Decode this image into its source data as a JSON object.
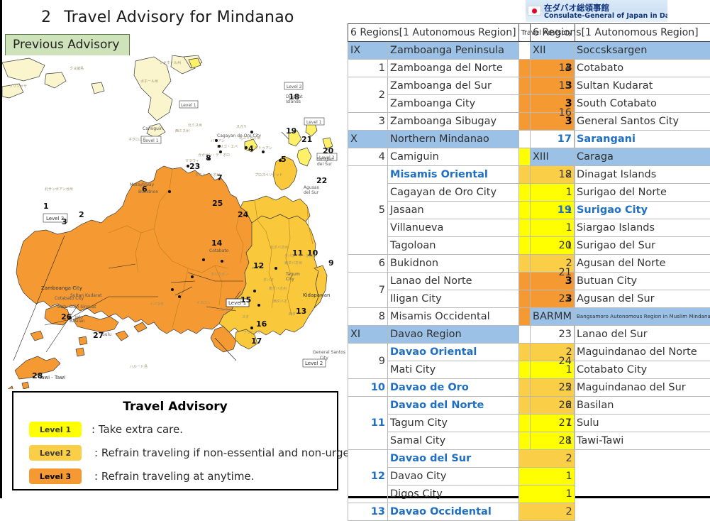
{
  "page": {
    "number": "2",
    "title": "Travel Advisory for Mindanao",
    "previous_advisory_button": "Previous Advisory"
  },
  "consulate": {
    "japanese": "在ダバオ総領事館",
    "english": "Consulate-General of Japan in Davao",
    "flag_icon": "japan-flag-icon",
    "accent_color": "#12367e"
  },
  "legend": {
    "title": "Travel Advisory",
    "items": [
      {
        "chip": "Level 1",
        "text": ": Take extra care.",
        "color": "#FFFF00"
      },
      {
        "chip": "Level 2",
        "text": ": Refrain traveling if non-essential and non-urgent.",
        "color": "#FBCE47"
      },
      {
        "chip": "Level 3",
        "text": ": Refrain traveling at anytime.",
        "color": "#F59A32"
      }
    ]
  },
  "table_headers": {
    "regions": "6 Regions[1 Autonomous Region]",
    "advisory": "Travel Advisory"
  },
  "table_left": [
    {
      "kind": "region",
      "code": "IX",
      "name": "Zamboanga Peninsula",
      "level": ""
    },
    {
      "kind": "item",
      "num": "1",
      "name": "Zamboanga del Norte",
      "level": "3"
    },
    {
      "kind": "item",
      "num": "2",
      "name": "Zamboanga del Sur",
      "level": "3",
      "rowspan": 2
    },
    {
      "kind": "sub",
      "name": "Zamboanga City",
      "level": "3"
    },
    {
      "kind": "item",
      "num": "3",
      "name": "Zamboanga Sibugay",
      "level": "3"
    },
    {
      "kind": "region",
      "code": "X",
      "name": "Northern Mindanao",
      "level": ""
    },
    {
      "kind": "item",
      "num": "4",
      "name": "Camiguin",
      "level": "1"
    },
    {
      "kind": "item",
      "num": "5",
      "name": "Misamis Oriental",
      "level": "2",
      "highlight": true,
      "rowspan": 5
    },
    {
      "kind": "sub",
      "name": "Cagayan de Oro City",
      "level": "1"
    },
    {
      "kind": "sub",
      "name": "Jasaan",
      "level": "1"
    },
    {
      "kind": "sub",
      "name": "Villanueva",
      "level": "1"
    },
    {
      "kind": "sub",
      "name": "Tagoloan",
      "level": "1"
    },
    {
      "kind": "item",
      "num": "6",
      "name": "Bukidnon",
      "level": "2"
    },
    {
      "kind": "item",
      "num": "7",
      "name": "Lanao del Norte",
      "level": "3",
      "rowspan": 2
    },
    {
      "kind": "sub",
      "name": "Iligan City",
      "level": "3"
    },
    {
      "kind": "item",
      "num": "8",
      "name": "Misamis Occidental",
      "level": "3"
    },
    {
      "kind": "region",
      "code": "XI",
      "name": "Davao Region",
      "level": ""
    },
    {
      "kind": "item",
      "num": "9",
      "name": "Davao Oriental",
      "level": "2",
      "highlight": true,
      "rowspan": 2
    },
    {
      "kind": "sub",
      "name": "Mati City",
      "level": "1"
    },
    {
      "kind": "item",
      "num": "10",
      "name": "Davao de Oro",
      "level": "2",
      "highlight": true,
      "num_hl": true
    },
    {
      "kind": "item",
      "num": "11",
      "name": "Davao del Norte",
      "level": "2",
      "highlight": true,
      "num_hl": true,
      "rowspan": 3
    },
    {
      "kind": "sub",
      "name": "Tagum City",
      "level": "1"
    },
    {
      "kind": "sub",
      "name": "Samal City",
      "level": "1"
    },
    {
      "kind": "item",
      "num": "12",
      "name": "Davao del Sur",
      "level": "2",
      "highlight": true,
      "num_hl": true,
      "rowspan": 3
    },
    {
      "kind": "sub",
      "name": "Davao City",
      "level": "1"
    },
    {
      "kind": "sub",
      "name": "Digos City",
      "level": "1"
    },
    {
      "kind": "item",
      "num": "13",
      "name": "Davao Occidental",
      "level": "2",
      "highlight": true,
      "num_hl": true
    }
  ],
  "table_right": [
    {
      "kind": "region",
      "code": "XII",
      "name": "Soccsksargen",
      "level": ""
    },
    {
      "kind": "item",
      "num": "14",
      "name": "Cotabato",
      "level": "3"
    },
    {
      "kind": "item",
      "num": "15",
      "name": "Sultan Kudarat",
      "level": "3"
    },
    {
      "kind": "item",
      "num": "16",
      "name": "South Cotabato",
      "level": "2",
      "rowspan": 2
    },
    {
      "kind": "sub",
      "name": "General Santos City",
      "level": "1"
    },
    {
      "kind": "item",
      "num": "17",
      "name": "Sarangani",
      "level": "3",
      "highlight": true,
      "num_hl": true
    },
    {
      "kind": "region",
      "code": "XIII",
      "name": "Caraga",
      "level": ""
    },
    {
      "kind": "item",
      "num": "18",
      "name": "Dinagat Islands",
      "level": "1"
    },
    {
      "kind": "item",
      "num": "19",
      "name": "Surigao del Norte",
      "level": "2",
      "num_hl": true,
      "rowspan": 3
    },
    {
      "kind": "sub",
      "name": "Surigao City",
      "level": "2",
      "highlight": true
    },
    {
      "kind": "sub",
      "name": "Siargao Islands",
      "level": "1"
    },
    {
      "kind": "item",
      "num": "20",
      "name": "Surigao del Sur",
      "level": "2"
    },
    {
      "kind": "item",
      "num": "21",
      "name": "Agusan del Norte",
      "level": "2",
      "rowspan": 2
    },
    {
      "kind": "sub",
      "name": "Butuan City",
      "level": "1"
    },
    {
      "kind": "item",
      "num": "22",
      "name": "Agusan del Sur",
      "level": "2"
    },
    {
      "kind": "region",
      "code": "BARMM",
      "name": "Bangsamoro Autonomous Region in Muslim Mindanao",
      "level": "",
      "small": true
    },
    {
      "kind": "item",
      "num": "23",
      "name": "Lanao del Sur",
      "level": "3"
    },
    {
      "kind": "item",
      "num": "24",
      "name": "Maguindanao del Norte",
      "level": "3",
      "rowspan": 2
    },
    {
      "kind": "sub",
      "name": "Cotabato City",
      "level": "3"
    },
    {
      "kind": "item",
      "num": "25",
      "name": "Maguindanao del Sur",
      "level": "3"
    },
    {
      "kind": "item",
      "num": "26",
      "name": "Basilan",
      "level": "3"
    },
    {
      "kind": "item",
      "num": "27",
      "name": "Sulu",
      "level": "3"
    },
    {
      "kind": "item",
      "num": "28",
      "name": "Tawi-Tawi",
      "level": "3"
    }
  ],
  "map": {
    "labels": [
      "Dinagat Islands",
      "Camiguin",
      "Cagayan de Oro City",
      "Malaybalay",
      "Bukidnon",
      "Zamboanga City",
      "Sultan Kudarat",
      "Cotabato City",
      "Datu Odin Sinsuat",
      "Basilan",
      "Jolo",
      "Sulu",
      "Tawi - Tawi",
      "Tagum City",
      "Kidapawan",
      "General Santos City",
      "Agusan del Sur",
      "Surigao del Sur",
      "Cotabato",
      "Level 1",
      "Level 2",
      "Level 3"
    ],
    "numbers": [
      "1",
      "2",
      "3",
      "4",
      "5",
      "6",
      "7",
      "8",
      "9",
      "10",
      "11",
      "12",
      "13",
      "14",
      "15",
      "16",
      "17",
      "18",
      "19",
      "20",
      "21",
      "22",
      "23",
      "24",
      "25",
      "26",
      "27",
      "28"
    ],
    "colors": {
      "level1": "#FFF06A",
      "level2": "#F9C93B",
      "level3": "#F59A32",
      "other": "#FBF5CE"
    }
  }
}
